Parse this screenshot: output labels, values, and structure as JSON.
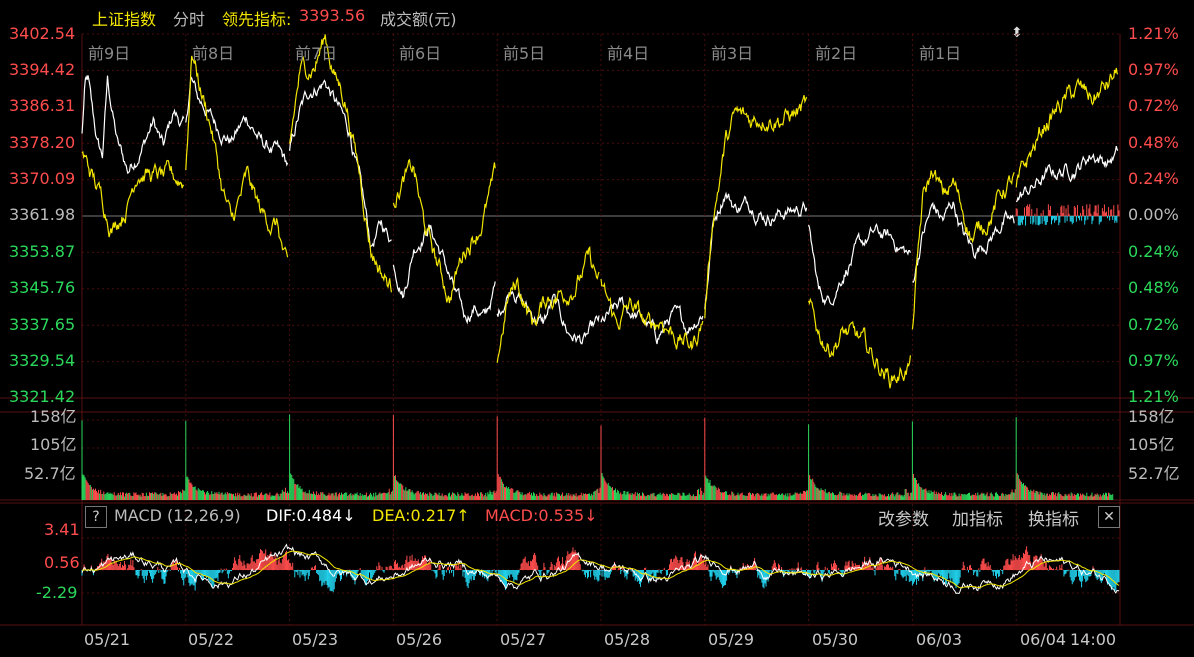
{
  "header": {
    "index_name": "上证指数",
    "mode": "分时",
    "leader_label": "领先指标:",
    "leader_value": "3393.56",
    "volume_label": "成交额(元)"
  },
  "price_axis": {
    "left": [
      "3402.54",
      "3394.42",
      "3386.31",
      "3378.20",
      "3370.09",
      "3361.98",
      "3353.87",
      "3345.76",
      "3337.65",
      "3329.54",
      "3321.42"
    ],
    "right": [
      "1.21%",
      "0.97%",
      "0.72%",
      "0.48%",
      "0.24%",
      "0.00%",
      "0.24%",
      "0.48%",
      "0.72%",
      "0.97%",
      "1.21%"
    ]
  },
  "day_labels": [
    "前9日",
    "前8日",
    "前7日",
    "前6日",
    "前5日",
    "前4日",
    "前3日",
    "前2日",
    "前1日"
  ],
  "volume_axis": [
    "158亿",
    "105亿",
    "52.7亿"
  ],
  "macd": {
    "help_label": "?",
    "title": "MACD (12,26,9)",
    "dif": "DIF:0.484↓",
    "dea": "DEA:0.217↑",
    "macd": "MACD:0.535↓",
    "buttons": [
      "改参数",
      "加指标",
      "换指标"
    ],
    "close_label": "✕",
    "axis": [
      "3.41",
      "0.56",
      "-2.29"
    ]
  },
  "dates": [
    "05/21",
    "05/22",
    "05/23",
    "05/26",
    "05/27",
    "05/28",
    "05/29",
    "05/30",
    "06/03",
    "06/04",
    "14:00"
  ],
  "colors": {
    "up": "#ff4c4c",
    "down": "#2bd85b",
    "price_line": "#ffffff",
    "leader_line": "#f2e600",
    "macd_neg": "#22d3ee",
    "grid": "#4a0d0d"
  },
  "chart_data": {
    "type": "line",
    "ylim": [
      3321.42,
      3402.54
    ],
    "base": 3361.98,
    "series": [
      {
        "anchors": [
          [
            0,
            3380
          ],
          [
            0.03,
            3391
          ],
          [
            0.06,
            3392
          ],
          [
            0.1,
            3385
          ],
          [
            0.15,
            3378
          ],
          [
            0.2,
            3375
          ],
          [
            0.25,
            3392
          ],
          [
            0.35,
            3378
          ],
          [
            0.45,
            3372
          ],
          [
            0.6,
            3378
          ],
          [
            0.7,
            3383
          ],
          [
            0.8,
            3377
          ],
          [
            0.9,
            3385
          ],
          [
            1,
            3382
          ]
        ]
      },
      {
        "anchors": [
          [
            0,
            3382
          ],
          [
            0.05,
            3393
          ],
          [
            0.12,
            3388
          ],
          [
            0.2,
            3386
          ],
          [
            0.3,
            3382
          ],
          [
            0.45,
            3379
          ],
          [
            0.6,
            3384
          ],
          [
            0.75,
            3378
          ],
          [
            0.9,
            3376
          ],
          [
            1,
            3373
          ]
        ]
      },
      {
        "anchors": [
          [
            0,
            3376
          ],
          [
            0.1,
            3385
          ],
          [
            0.2,
            3390
          ],
          [
            0.35,
            3392
          ],
          [
            0.5,
            3385
          ],
          [
            0.6,
            3380
          ],
          [
            0.7,
            3368
          ],
          [
            0.8,
            3355
          ],
          [
            0.9,
            3360
          ],
          [
            1,
            3357
          ]
        ]
      },
      {
        "anchors": [
          [
            0,
            3352
          ],
          [
            0.1,
            3345
          ],
          [
            0.2,
            3355
          ],
          [
            0.35,
            3360
          ],
          [
            0.5,
            3352
          ],
          [
            0.6,
            3345
          ],
          [
            0.7,
            3339
          ],
          [
            0.8,
            3342
          ],
          [
            0.9,
            3339
          ],
          [
            1,
            3346
          ]
        ]
      },
      {
        "anchors": [
          [
            0,
            3340
          ],
          [
            0.15,
            3347
          ],
          [
            0.3,
            3341
          ],
          [
            0.45,
            3338
          ],
          [
            0.55,
            3343
          ],
          [
            0.7,
            3336
          ],
          [
            0.85,
            3334
          ],
          [
            1,
            3338
          ]
        ]
      },
      {
        "anchors": [
          [
            0,
            3338
          ],
          [
            0.2,
            3342
          ],
          [
            0.4,
            3339
          ],
          [
            0.55,
            3335
          ],
          [
            0.7,
            3340
          ],
          [
            0.85,
            3337
          ],
          [
            1,
            3341
          ]
        ]
      },
      {
        "anchors": [
          [
            0,
            3341
          ],
          [
            0.08,
            3360
          ],
          [
            0.2,
            3368
          ],
          [
            0.3,
            3364
          ],
          [
            0.45,
            3365
          ],
          [
            0.6,
            3362
          ],
          [
            0.8,
            3363
          ],
          [
            1,
            3364
          ]
        ]
      },
      {
        "anchors": [
          [
            0,
            3359
          ],
          [
            0.1,
            3345
          ],
          [
            0.2,
            3343
          ],
          [
            0.35,
            3350
          ],
          [
            0.5,
            3355
          ],
          [
            0.65,
            3358
          ],
          [
            0.8,
            3357
          ],
          [
            1,
            3353
          ]
        ]
      },
      {
        "anchors": [
          [
            0,
            3347
          ],
          [
            0.1,
            3358
          ],
          [
            0.2,
            3364
          ],
          [
            0.3,
            3361
          ],
          [
            0.4,
            3365
          ],
          [
            0.5,
            3358
          ],
          [
            0.6,
            3354
          ],
          [
            0.75,
            3357
          ],
          [
            0.9,
            3361
          ],
          [
            1,
            3360
          ]
        ]
      },
      {
        "anchors": [
          [
            0,
            3366
          ],
          [
            0.15,
            3368
          ],
          [
            0.3,
            3371
          ],
          [
            0.45,
            3372
          ],
          [
            0.6,
            3373
          ],
          [
            0.75,
            3376
          ],
          [
            0.9,
            3374
          ],
          [
            1,
            3376
          ]
        ]
      }
    ],
    "leader_series": [
      {
        "anchors": [
          [
            0,
            3376
          ],
          [
            0.15,
            3368
          ],
          [
            0.3,
            3360
          ],
          [
            0.45,
            3365
          ],
          [
            0.55,
            3373
          ],
          [
            0.7,
            3371
          ],
          [
            0.85,
            3370
          ],
          [
            1,
            3370
          ]
        ]
      },
      {
        "anchors": [
          [
            0,
            3372
          ],
          [
            0.06,
            3399
          ],
          [
            0.15,
            3390
          ],
          [
            0.25,
            3382
          ],
          [
            0.35,
            3369
          ],
          [
            0.45,
            3360
          ],
          [
            0.6,
            3370
          ],
          [
            0.75,
            3362
          ],
          [
            0.9,
            3360
          ],
          [
            1,
            3349
          ]
        ]
      },
      {
        "anchors": [
          [
            0,
            3378
          ],
          [
            0.1,
            3394
          ],
          [
            0.25,
            3396
          ],
          [
            0.35,
            3402
          ],
          [
            0.45,
            3393
          ],
          [
            0.55,
            3388
          ],
          [
            0.7,
            3370
          ],
          [
            0.8,
            3355
          ],
          [
            0.9,
            3350
          ],
          [
            1,
            3346
          ]
        ]
      },
      {
        "anchors": [
          [
            0,
            3366
          ],
          [
            0.1,
            3370
          ],
          [
            0.2,
            3372
          ],
          [
            0.3,
            3360
          ],
          [
            0.45,
            3350
          ],
          [
            0.55,
            3344
          ],
          [
            0.7,
            3355
          ],
          [
            0.85,
            3360
          ],
          [
            1,
            3370
          ]
        ]
      },
      {
        "anchors": [
          [
            0,
            3330
          ],
          [
            0.1,
            3343
          ],
          [
            0.2,
            3347
          ],
          [
            0.35,
            3338
          ],
          [
            0.5,
            3344
          ],
          [
            0.65,
            3345
          ],
          [
            0.8,
            3348
          ],
          [
            0.9,
            3352
          ],
          [
            1,
            3347
          ]
        ]
      },
      {
        "anchors": [
          [
            0,
            3347
          ],
          [
            0.15,
            3338
          ],
          [
            0.3,
            3342
          ],
          [
            0.45,
            3337
          ],
          [
            0.6,
            3339
          ],
          [
            0.75,
            3335
          ],
          [
            0.9,
            3333
          ],
          [
            1,
            3339
          ]
        ]
      },
      {
        "anchors": [
          [
            0,
            3340
          ],
          [
            0.08,
            3362
          ],
          [
            0.2,
            3378
          ],
          [
            0.3,
            3384
          ],
          [
            0.45,
            3383
          ],
          [
            0.6,
            3385
          ],
          [
            0.8,
            3384
          ],
          [
            1,
            3386
          ]
        ]
      },
      {
        "anchors": [
          [
            0,
            3342
          ],
          [
            0.1,
            3336
          ],
          [
            0.2,
            3333
          ],
          [
            0.35,
            3336
          ],
          [
            0.5,
            3334
          ],
          [
            0.65,
            3330
          ],
          [
            0.8,
            3326
          ],
          [
            0.9,
            3327
          ],
          [
            1,
            3329
          ]
        ]
      },
      {
        "anchors": [
          [
            0,
            3338
          ],
          [
            0.1,
            3365
          ],
          [
            0.2,
            3372
          ],
          [
            0.3,
            3366
          ],
          [
            0.4,
            3369
          ],
          [
            0.5,
            3363
          ],
          [
            0.6,
            3357
          ],
          [
            0.75,
            3362
          ],
          [
            0.9,
            3368
          ],
          [
            1,
            3370
          ]
        ]
      },
      {
        "anchors": [
          [
            0,
            3368
          ],
          [
            0.15,
            3376
          ],
          [
            0.3,
            3383
          ],
          [
            0.45,
            3387
          ],
          [
            0.6,
            3390
          ],
          [
            0.75,
            3388
          ],
          [
            0.9,
            3391
          ],
          [
            1,
            3394
          ]
        ]
      }
    ],
    "volume_ylim": [
      0,
      158
    ],
    "macd_ylim": [
      -3.41,
      3.41
    ]
  }
}
